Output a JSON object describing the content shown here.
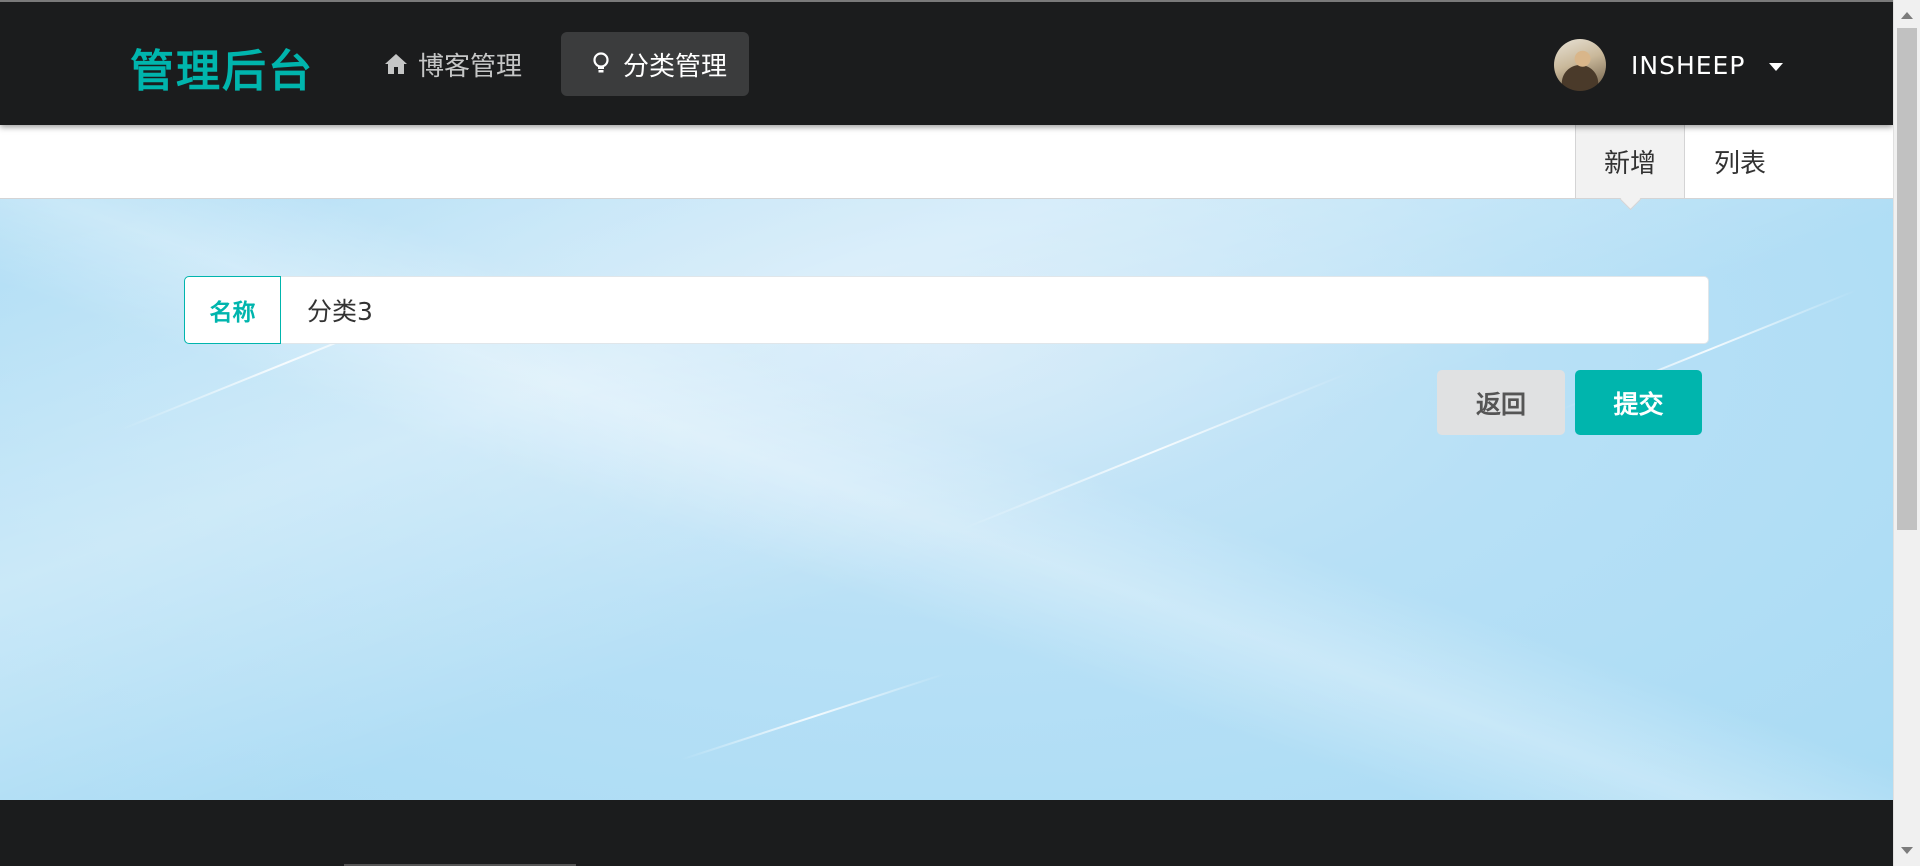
{
  "header": {
    "brand": "管理后台",
    "nav": [
      {
        "label": "博客管理",
        "icon": "home-icon"
      },
      {
        "label": "分类管理",
        "icon": "lightbulb-icon",
        "active": true
      }
    ],
    "user": {
      "name": "INSHEEP",
      "avatar": "avatar-photo"
    }
  },
  "submenu": {
    "items": [
      {
        "label": "新增",
        "active": true
      },
      {
        "label": "列表"
      }
    ]
  },
  "form": {
    "name_label": "名称",
    "name_value": "分类3",
    "back_label": "返回",
    "submit_label": "提交"
  },
  "colors": {
    "accent": "#00b5ad",
    "nav_bg": "#1b1c1d",
    "main_bg": "#b7e0f6"
  }
}
